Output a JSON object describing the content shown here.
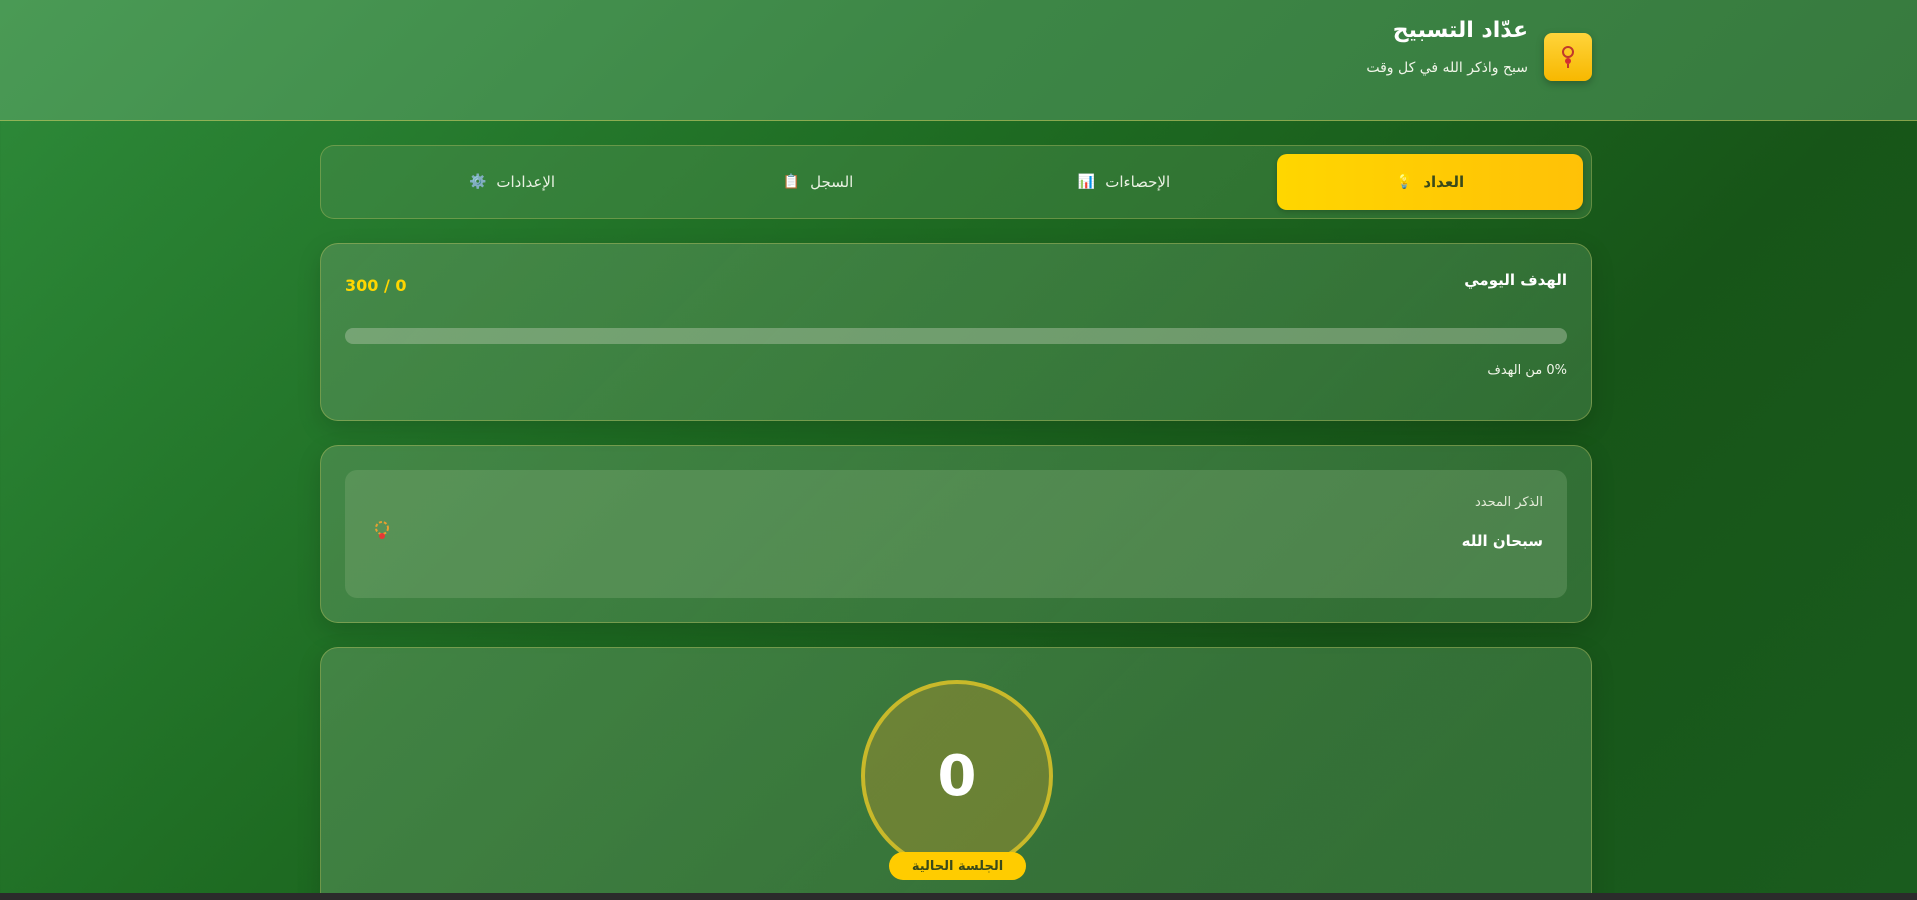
{
  "header": {
    "title": "عدّاد التسبيح",
    "subtitle": "سبح واذكر الله في كل وقت",
    "logo_icon": "prayer-beads-icon"
  },
  "tabs": [
    {
      "label": "العداد",
      "icon": "💡",
      "icon_name": "counter-icon",
      "active": true
    },
    {
      "label": "الإحصاءات",
      "icon": "📊",
      "icon_name": "chart-icon",
      "active": false
    },
    {
      "label": "السجل",
      "icon": "📋",
      "icon_name": "clipboard-icon",
      "active": false
    },
    {
      "label": "الإعدادات",
      "icon": "⚙️",
      "icon_name": "gear-icon",
      "active": false
    }
  ],
  "goal": {
    "title": "الهدف اليومي",
    "count_text": "300 / 0",
    "progress": 0,
    "percent_text": "0% من الهدف"
  },
  "dhikr": {
    "label": "الذكر المحدد",
    "value": "سبحان الله",
    "icon": "prayer-beads-icon"
  },
  "counter": {
    "value": "0",
    "session_label": "الجلسة الحالية"
  },
  "colors": {
    "accent": "#ffd600",
    "background": "#1e6b22"
  }
}
